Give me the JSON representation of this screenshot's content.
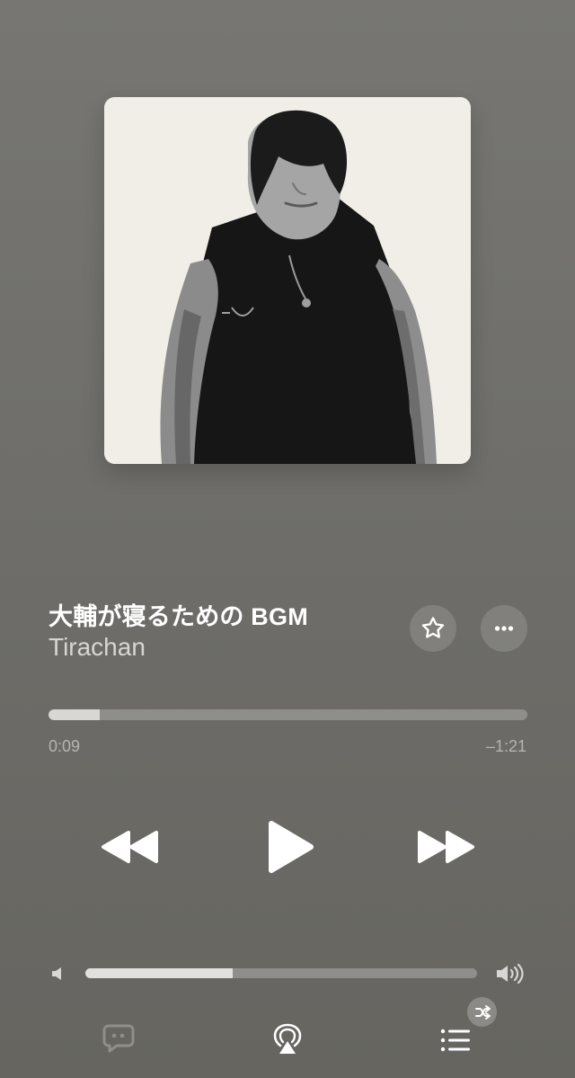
{
  "now_playing": {
    "title": "大輔が寝るための BGM",
    "artist": "Tirachan",
    "progress_fraction": 0.107,
    "elapsed": "0:09",
    "remaining": "–1:21",
    "volume_fraction": 0.375
  },
  "icons": {
    "favorite": "star-outline-icon",
    "more": "ellipsis-icon",
    "rewind": "backward-icon",
    "play": "play-icon",
    "forward": "forward-icon",
    "volume_low": "speaker-low-icon",
    "volume_high": "speaker-high-icon",
    "lyrics": "lyrics-icon",
    "airplay": "airplay-icon",
    "queue": "list-icon",
    "shuffle": "shuffle-icon"
  },
  "colors": {
    "background": "#777672",
    "text_primary": "#ffffff",
    "text_secondary": "#d7d6d2",
    "muted": "#b5b4b0"
  }
}
